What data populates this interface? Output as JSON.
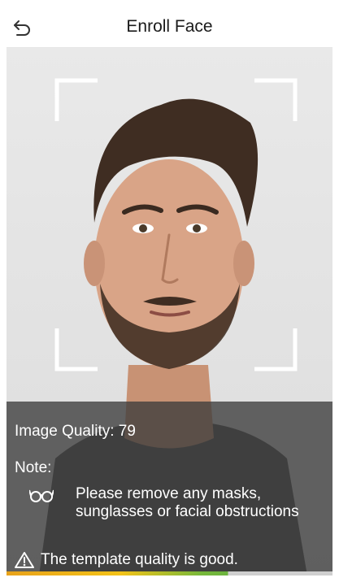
{
  "header": {
    "title": "Enroll Face",
    "back_icon": "back-arrow-icon"
  },
  "camera": {
    "face_frame_icon": "face-frame-corners-icon"
  },
  "info": {
    "image_quality": "Image Quality: 79",
    "note_label": "Note:",
    "note_icon": "glasses-icon",
    "note_text": "Please remove any masks, sunglasses or facial obstructions",
    "status_icon": "warning-triangle-icon",
    "status_text": "The template quality is good."
  },
  "quality_bar": {
    "fraction": 0.68,
    "colors": [
      "#e8a21a",
      "#f3c218",
      "#6cb33e",
      "#cfcfcf"
    ]
  }
}
